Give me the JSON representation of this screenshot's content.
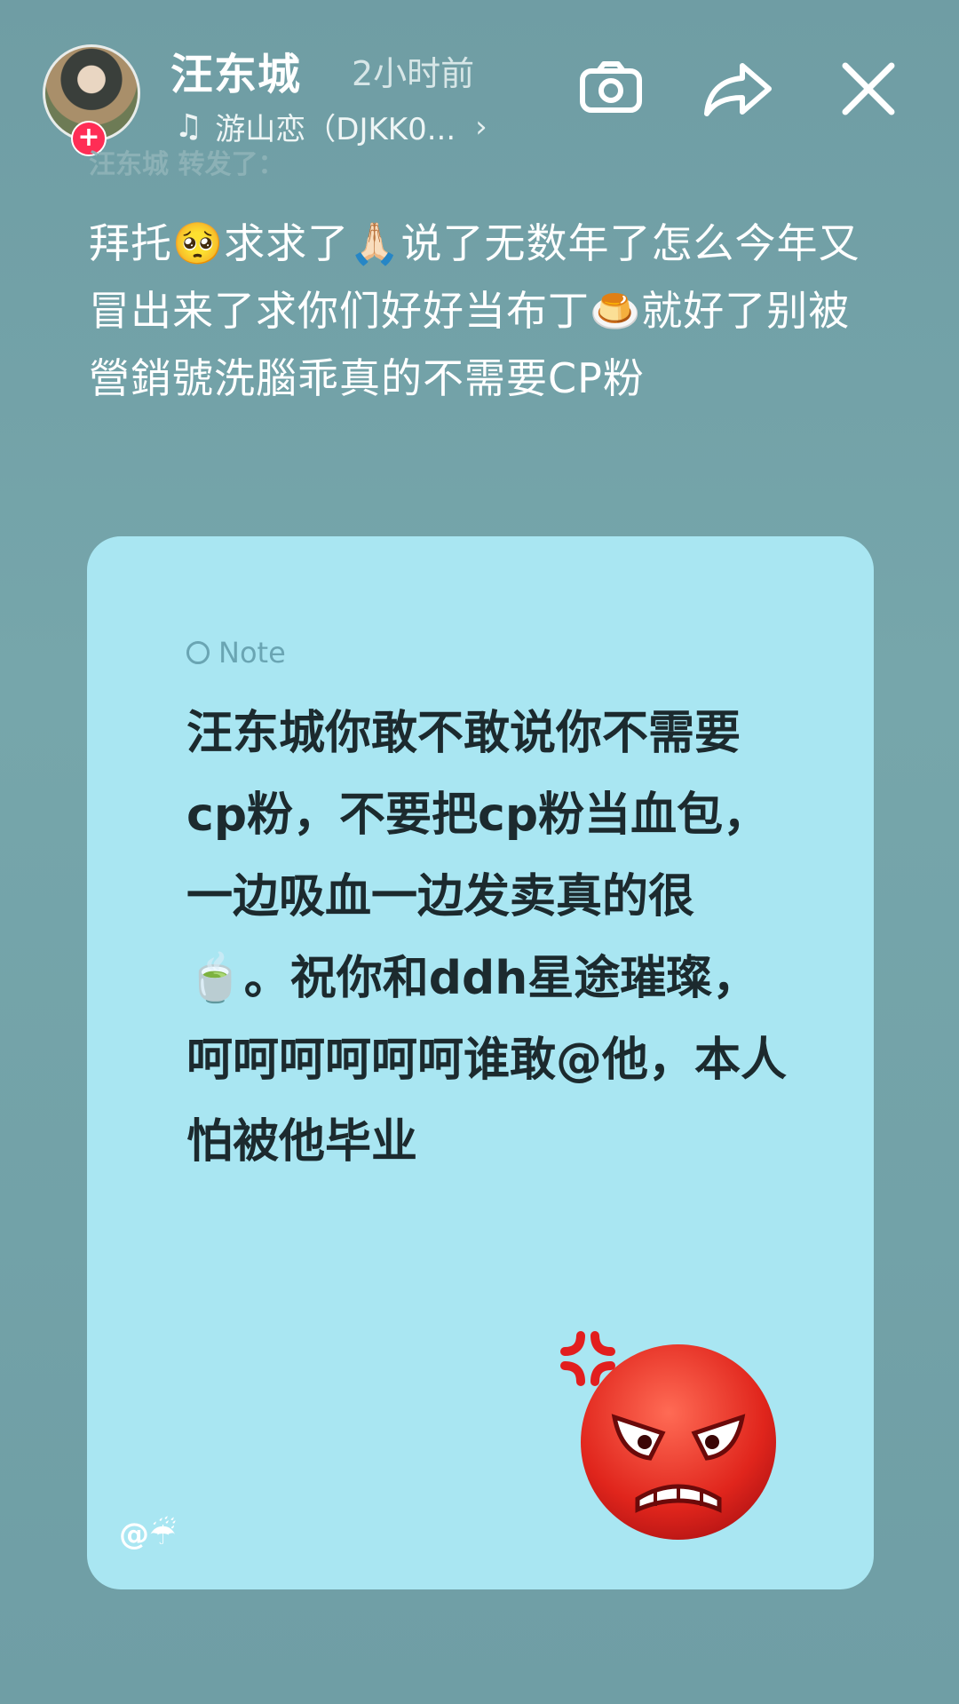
{
  "header": {
    "username": "汪东城",
    "time": "2小时前",
    "music": "游山恋（DJKK0...",
    "repost_label": "汪东城  转发了："
  },
  "post": {
    "text": "拜托🥺求求了🙏🏻说了无数年了怎么今年又冒出来了求你们好好当布丁🍮就好了别被營銷號洗腦乖真的不需要CP粉"
  },
  "note": {
    "label": "Note",
    "text": "汪东城你敢不敢说你不需要cp粉，不要把cp粉当血包，一边吸血一边发卖真的很🍵。祝你和ddh星途璀璨，呵呵呵呵呵呵谁敢@他，本人怕被他毕业",
    "mention": "@☔"
  },
  "icons": [
    "camera-icon",
    "share-icon",
    "close-icon",
    "music-note-icon",
    "angry-face-icon"
  ],
  "colors": {
    "background": "#6f9da4",
    "card": "#a9e6f2",
    "follow_badge": "#ff2d55"
  }
}
